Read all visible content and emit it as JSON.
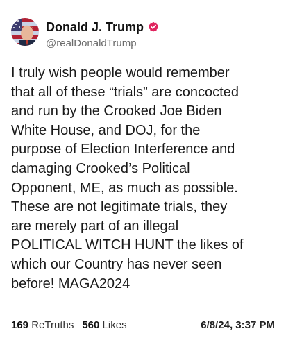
{
  "author": {
    "display_name": "Donald J. Trump",
    "handle": "@realDonaldTrump",
    "verified_color": "#e0245e",
    "avatar_icon": "flag-portrait-avatar"
  },
  "post": {
    "text": "I truly wish people would remember\nthat all of these “trials” are concocted\nand run by the Crooked Joe Biden\nWhite House, and DOJ, for the\npurpose of Election Interference and\ndamaging Crooked’s Political\nOpponent, ME, as much as possible.\nThese are not legitimate trials, they\nare merely part of an illegal\nPOLITICAL WITCH HUNT the likes of\nwhich our Country has never seen\nbefore! MAGA2024"
  },
  "stats": {
    "retruths_count": "169",
    "retruths_label": "ReTruths",
    "likes_count": "560",
    "likes_label": "Likes",
    "timestamp": "6/8/24, 3:37 PM"
  }
}
